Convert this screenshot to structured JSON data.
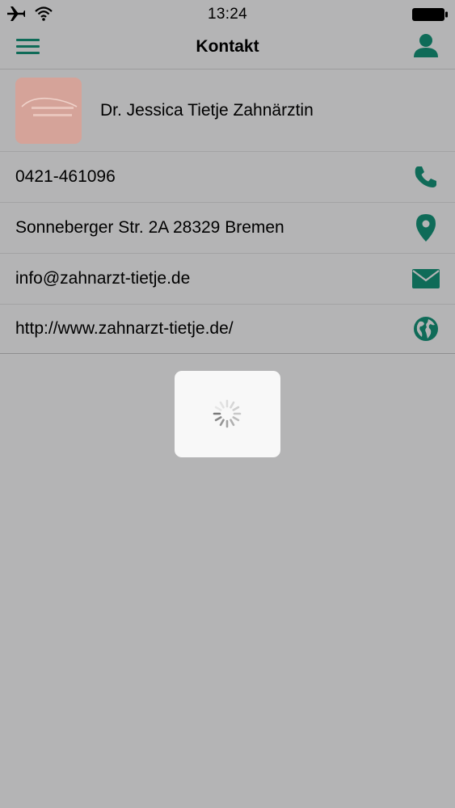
{
  "status_bar": {
    "time": "13:24",
    "icons": [
      "airplane-icon",
      "wifi-icon",
      "battery-icon"
    ]
  },
  "nav": {
    "title": "Kontakt",
    "left_icon": "menu-icon",
    "right_icon": "user-icon"
  },
  "contact": {
    "name": "Dr. Jessica Tietje Zahnärztin",
    "phone": "0421-461096",
    "address": "Sonneberger Str. 2A 28329 Bremen",
    "email": "info@zahnarzt-tietje.de",
    "website": "http://www.zahnarzt-tietje.de/"
  },
  "row_icons": {
    "phone": "phone-icon",
    "address": "map-pin-icon",
    "email": "envelope-icon",
    "website": "globe-icon"
  },
  "loading": {
    "icon": "loading-spinner-icon"
  },
  "colors": {
    "accent": "#0f6b58",
    "background": "#b4b4b5",
    "logo": "#d5a399",
    "loading_box": "#f8f8f8"
  }
}
